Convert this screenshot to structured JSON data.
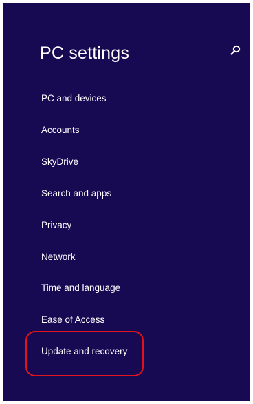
{
  "header": {
    "title": "PC settings",
    "search_icon": "search-icon"
  },
  "nav": {
    "items": [
      {
        "label": "PC and devices"
      },
      {
        "label": "Accounts"
      },
      {
        "label": "SkyDrive"
      },
      {
        "label": "Search and apps"
      },
      {
        "label": "Privacy"
      },
      {
        "label": "Network"
      },
      {
        "label": "Time and language"
      },
      {
        "label": "Ease of Access"
      },
      {
        "label": "Update and recovery"
      }
    ]
  },
  "colors": {
    "background": "#180a52",
    "text": "#ffffff",
    "highlight": "#e0151b"
  }
}
